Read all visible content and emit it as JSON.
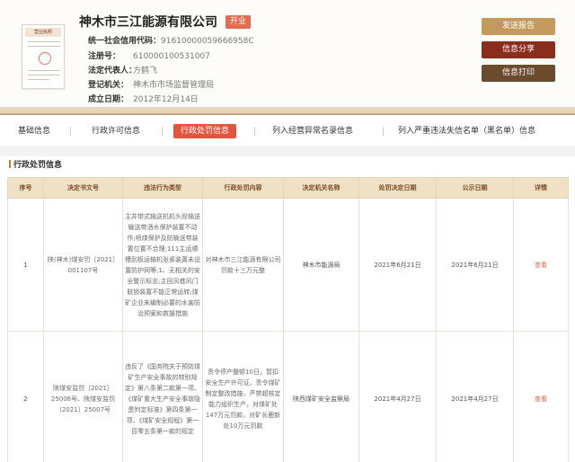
{
  "company": {
    "name": "神木市三江能源有限公司",
    "status": "开业",
    "fields": [
      {
        "key": "统一社会信用代码：",
        "value": "91610000059666958C"
      },
      {
        "key": "注册号：",
        "value": "610000100531007"
      },
      {
        "key": "法定代表人：",
        "value": "方鹤飞"
      },
      {
        "key": "登记机关：",
        "value": "神木市市场监督管理局"
      },
      {
        "key": "成立日期：",
        "value": "2012年12月14日"
      }
    ]
  },
  "actions": {
    "send_report": "发送报告",
    "share": "信息分享",
    "print": "信息打印"
  },
  "license": {
    "title": "营业执照"
  },
  "tabs": [
    "基础信息",
    "行政许可信息",
    "行政处罚信息",
    "列入经营异常名录信息",
    "列入严重违法失信名单（黑名单）信息"
  ],
  "active_tab": 2,
  "section": {
    "title": "行政处罚信息"
  },
  "table": {
    "headers": [
      "序号",
      "决定书文号",
      "违法行为类型",
      "行政处罚内容",
      "决定机关名称",
      "处罚决定日期",
      "公示日期",
      "详情"
    ],
    "rows": [
      {
        "no": "1",
        "doc_no": "陕(神木)煤安罚〔2021〕001107号",
        "violation": "主井带式输送机机头段输送输送带洒水保护装置不动作;喷煤保护及防输送带装置位置不合理;111主运顺槽刮板运输机张紧装置未设置防护网等;1、无相关的安全警示标志;主回风巷风门联锁装置不能正常运转;煤矿企业未编制必要的水害防治预案和救援措施",
        "penalty": "对神木市三江能源有限公司罚款十三万元整",
        "authority": "神木市能源局",
        "decision_date": "2021年6月21日",
        "publish_date": "2021年6月21日",
        "detail": "查看"
      },
      {
        "no": "2",
        "doc_no": "陕煤安监罚〔2021〕25006号、陕煤安监罚〔2021〕25007号",
        "violation": "违反了《国务院关于预防煤矿生产安全事故的特别规定》第八条第二款第一项、《煤矿重大生产安全事故隐患判定标准》第四条第一项、《煤矿安全规程》第一百零五条第一款的规定",
        "penalty": "责令停产整顿10日，暂扣安全生产许可证，责令煤矿制定整改措施，严禁超核定能力组织生产，对煤矿处147万元罚款，对矿长鹿新处10万元罚款",
        "authority": "陕西煤矿安全监察局",
        "decision_date": "2021年4月27日",
        "publish_date": "2021年4月27日",
        "detail": "查看"
      }
    ]
  },
  "colors": {
    "accent": "#e2543d",
    "header_bg": "#efe0c6",
    "btn_gold": "#c49a5c",
    "btn_red": "#8b2d1c",
    "btn_brown": "#6b4a2e"
  }
}
